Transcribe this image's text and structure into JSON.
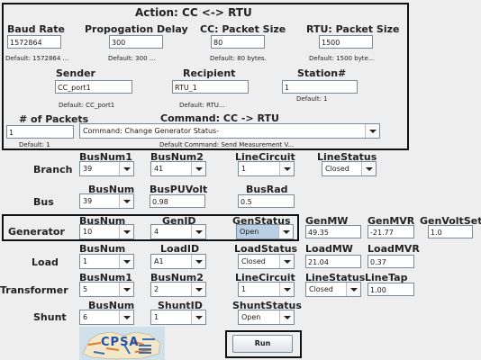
{
  "action": {
    "title": "Action: CC <-> RTU",
    "baud_rate": {
      "label": "Baud Rate",
      "value": "1572864",
      "default": "Default: 1572864 ..."
    },
    "prop_delay": {
      "label": "Propogation Delay",
      "value": "300",
      "default": "Default: 300 ..."
    },
    "cc_packet": {
      "label": "CC: Packet Size",
      "value": "80",
      "default": "Default: 80 bytes."
    },
    "rtu_packet": {
      "label": "RTU: Packet Size",
      "value": "1500",
      "default": "Default: 1500 byte..."
    },
    "sender": {
      "label": "Sender",
      "value": "CC_port1",
      "default": "Default: CC_port1"
    },
    "recipient": {
      "label": "Recipient",
      "value": "RTU_1",
      "default": "Default: RTU..."
    },
    "station": {
      "label": "Station#",
      "value": "1",
      "default": "Default: 1"
    },
    "packets": {
      "label": "# of Packets",
      "value": "1",
      "default": "Default: 1"
    },
    "command": {
      "label": "Command: CC -> RTU",
      "value": "Command: Change Generator Status-",
      "default": "Default Command: Send Measurement V..."
    }
  },
  "branch": {
    "label": "Branch",
    "busnum1": {
      "label": "BusNum1",
      "value": "39"
    },
    "busnum2": {
      "label": "BusNum2",
      "value": "41"
    },
    "linecircuit": {
      "label": "LineCircuit",
      "value": "1"
    },
    "linestatus": {
      "label": "LineStatus",
      "value": "Closed"
    }
  },
  "bus": {
    "label": "Bus",
    "busnum": {
      "label": "BusNum",
      "value": "39"
    },
    "buspuvolt": {
      "label": "BusPUVolt",
      "value": "0.98"
    },
    "busrad": {
      "label": "BusRad",
      "value": "0.5"
    }
  },
  "generator": {
    "label": "Generator",
    "busnum": {
      "label": "BusNum",
      "value": "10"
    },
    "genid": {
      "label": "GenID",
      "value": "4"
    },
    "genstatus": {
      "label": "GenStatus",
      "value": "Open"
    },
    "genmw": {
      "label": "GenMW",
      "value": "49.35"
    },
    "genmvr": {
      "label": "GenMVR",
      "value": "-21.77"
    },
    "genvoltset": {
      "label": "GenVoltSet",
      "value": "1.0"
    }
  },
  "load": {
    "label": "Load",
    "busnum": {
      "label": "BusNum",
      "value": "1"
    },
    "loadid": {
      "label": "LoadID",
      "value": "A1"
    },
    "loadstatus": {
      "label": "LoadStatus",
      "value": "Closed"
    },
    "loadmw": {
      "label": "LoadMW",
      "value": "21.04"
    },
    "loadmvr": {
      "label": "LoadMVR",
      "value": "0.37"
    }
  },
  "transformer": {
    "label": "Transformer",
    "busnum1": {
      "label": "BusNum1",
      "value": "5"
    },
    "busnum2": {
      "label": "BusNum2",
      "value": "2"
    },
    "linecircuit": {
      "label": "LineCircuit",
      "value": "1"
    },
    "linestatus": {
      "label": "LineStatus",
      "value": "Closed"
    },
    "linetap": {
      "label": "LineTap",
      "value": "1.00"
    }
  },
  "shunt": {
    "label": "Shunt",
    "busnum": {
      "label": "BusNum",
      "value": "6"
    },
    "shuntid": {
      "label": "ShuntID",
      "value": "1"
    },
    "shuntstatus": {
      "label": "ShuntStatus",
      "value": "Open"
    }
  },
  "logo": {
    "text": "CPSA"
  },
  "run_label": "Run"
}
